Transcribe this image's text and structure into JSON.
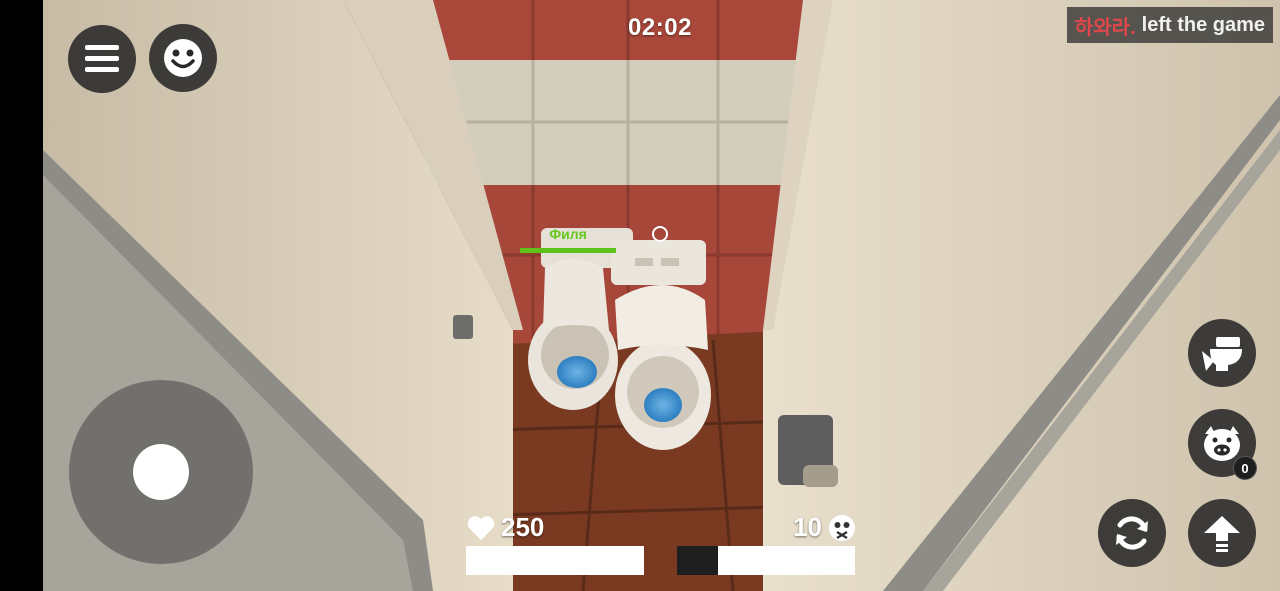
{
  "hud": {
    "timer": "02:02",
    "killfeed": {
      "player": "하와라.",
      "message": "left the game"
    },
    "nametag": {
      "name": "Филя",
      "health_fraction": 1.0
    },
    "health": {
      "value": "250",
      "fill_fraction": 1.0
    },
    "kills": {
      "value": "10",
      "fill_fraction": 0.23
    },
    "pig_count": "0"
  },
  "buttons": {
    "menu": {
      "icon": "hamburger-menu-icon"
    },
    "emote": {
      "icon": "smiley-face-icon"
    },
    "toilet_action": {
      "icon": "toilet-icon"
    },
    "pig": {
      "icon": "pig-face-icon"
    },
    "swap": {
      "icon": "rotate-arrows-icon"
    },
    "jump": {
      "icon": "up-arrow-icon"
    }
  },
  "colors": {
    "killfeed_player": "#e0474b",
    "nametag": "#64c81e",
    "button_bg": "#282828"
  }
}
